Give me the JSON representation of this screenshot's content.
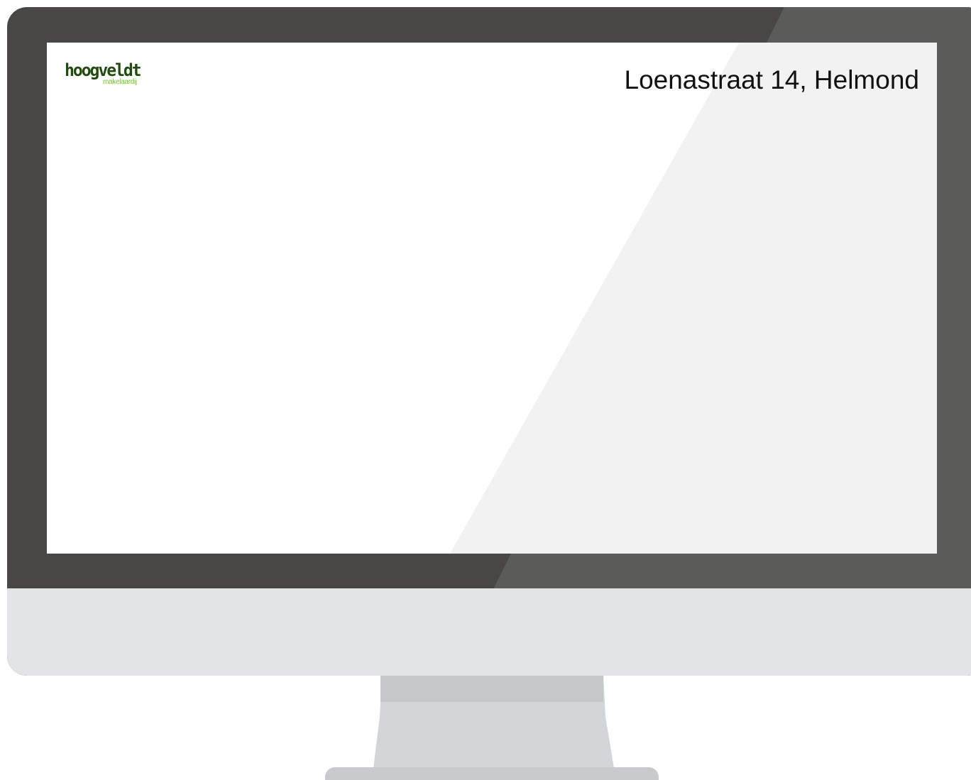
{
  "screen": {
    "logo": {
      "main": "hoogveldt",
      "sub": "makelaardij"
    },
    "address": "Loenastraat 14, Helmond"
  },
  "colors": {
    "bezel": "#484745",
    "chin": "#e3e4e8",
    "logo_dark_green": "#234a12",
    "logo_light_green": "#6fbf2e"
  }
}
